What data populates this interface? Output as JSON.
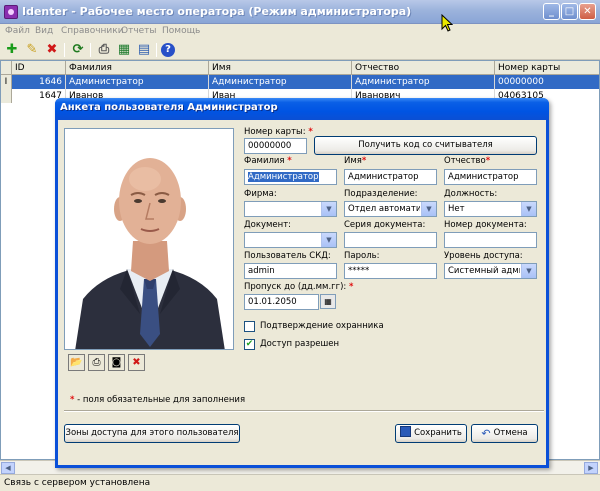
{
  "window": {
    "title": "Identer - Рабочее место оператора (Режим администратора)"
  },
  "menu": [
    "Файл",
    "Вид",
    "Справочники",
    "Отчеты",
    "Помощь"
  ],
  "grid": {
    "columns": [
      "ID",
      "Фамилия",
      "Имя",
      "Отчество",
      "Номер карты"
    ],
    "rows": [
      {
        "id": "1646",
        "last": "Администратор",
        "first": "Администратор",
        "middle": "Администратор",
        "card": "00000000"
      },
      {
        "id": "1647",
        "last": "Иванов",
        "first": "Иван",
        "middle": "Иванович",
        "card": "04063105"
      }
    ],
    "row_indicator": "I"
  },
  "status": {
    "text": "Связь с сервером установлена"
  },
  "dialog": {
    "title": "Анкета пользователя Администратор",
    "card_label": "Номер карты:",
    "card_value": "00000000",
    "read_card_button": "Получить код со считывателя",
    "last_label": "Фамилия",
    "last_value": "Администратор",
    "first_label": "Имя",
    "first_value": "Администратор",
    "middle_label": "Отчество",
    "middle_value": "Администратор",
    "company_label": "Фирма:",
    "company_value": "",
    "department_label": "Подразделение:",
    "department_value": "Отдел автоматиза",
    "position_label": "Должность:",
    "position_value": "Нет",
    "doc_label": "Документ:",
    "doc_value": "",
    "doc_series_label": "Серия документа:",
    "doc_series_value": "",
    "doc_number_label": "Номер документа:",
    "doc_number_value": "",
    "skd_user_label": "Пользователь СКД:",
    "skd_user_value": "admin",
    "password_label": "Пароль:",
    "password_value": "*****",
    "access_level_label": "Уровень доступа:",
    "access_level_value": "Системный админ",
    "pass_label": "Пропуск до (дд.мм.гг):",
    "pass_value": "01.01.2050",
    "guard_confirm_label": "Подтверждение охранника",
    "guard_confirm_checked": false,
    "access_allowed_label": "Доступ разрешен",
    "access_allowed_checked": true,
    "required_note": "- поля обязательные для заполнения",
    "required_star": "*",
    "zones_button": "Зоны доступа для этого пользователя",
    "save_button": "Сохранить",
    "cancel_button": "Отмена"
  }
}
